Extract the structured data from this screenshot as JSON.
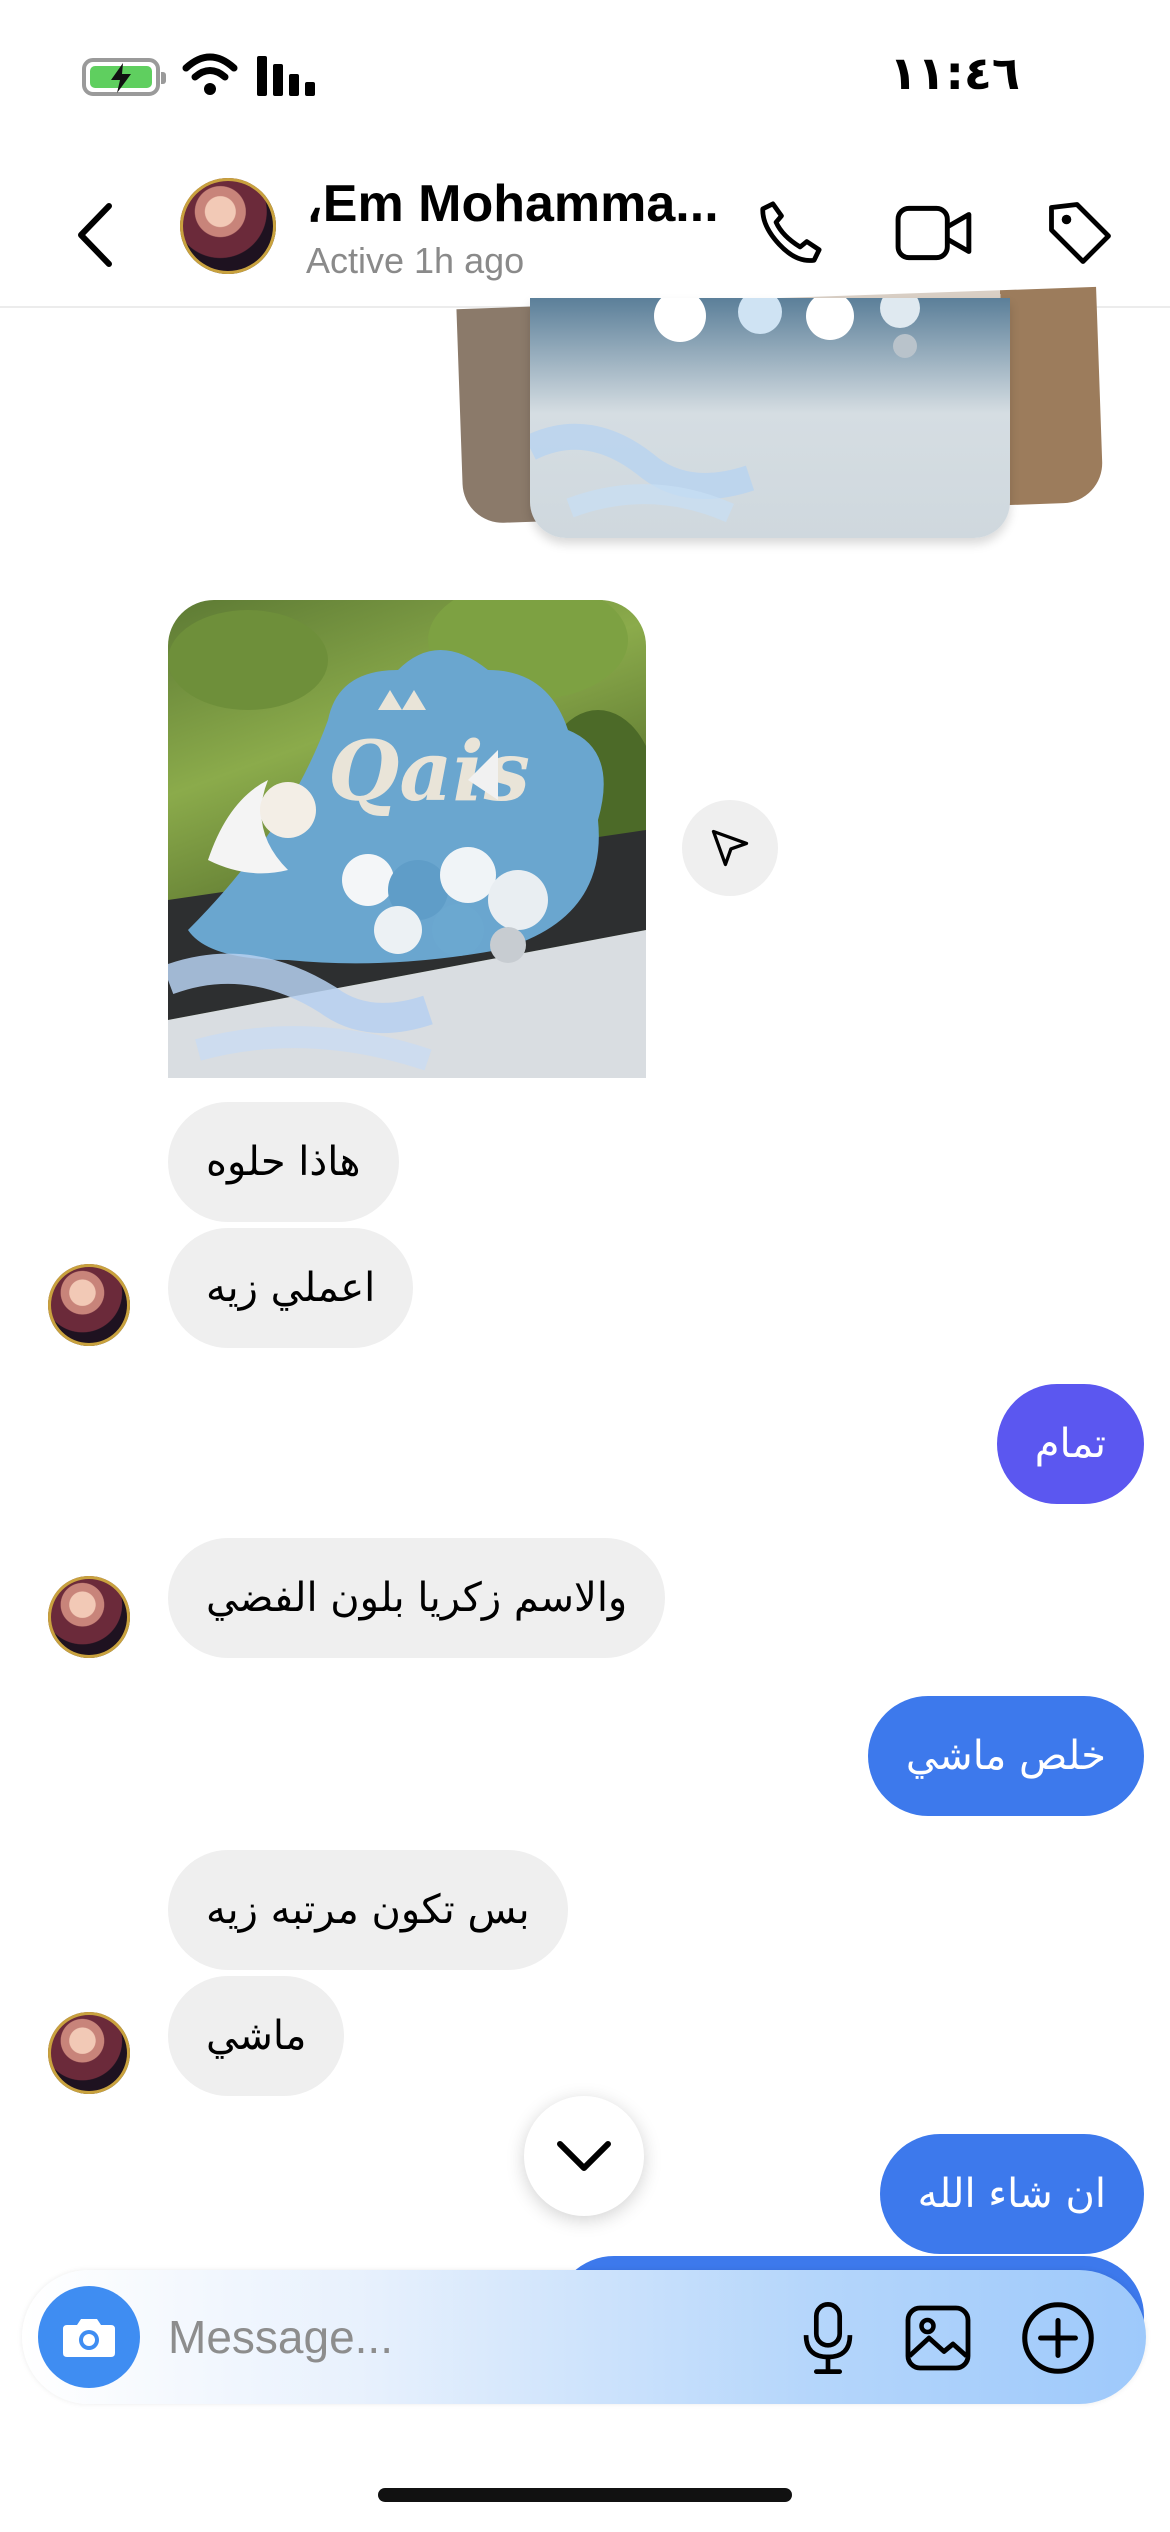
{
  "status_bar": {
    "time": "١١:٤٦",
    "icons": [
      "battery-charging-icon",
      "wifi-icon",
      "signal-icon"
    ]
  },
  "header": {
    "contact_name": "،Em Mohamma...",
    "contact_status": "Active 1h ago",
    "icons": [
      "back-arrow-icon",
      "phone-icon",
      "video-call-icon",
      "tag-icon"
    ]
  },
  "messages": [
    {
      "side": "received",
      "text": "هاذا حلوه"
    },
    {
      "side": "received",
      "text": "اعملي زيه"
    },
    {
      "side": "sent",
      "text": "تمام"
    },
    {
      "side": "received",
      "text": "والاسم زكريا بلون الفضي"
    },
    {
      "side": "sent",
      "text": "خلص ماشي"
    },
    {
      "side": "received",
      "text": "بس تكون مرتبه زيه"
    },
    {
      "side": "received",
      "text": "ماشي"
    },
    {
      "side": "sent",
      "text": "ان شاء الله"
    }
  ],
  "post": {
    "image_text": "Qais"
  },
  "composer": {
    "placeholder": "Message...",
    "icons": [
      "camera-icon",
      "microphone-icon",
      "gallery-icon",
      "plus-circle-icon"
    ]
  },
  "colors": {
    "sent_purple": "#5b57f0",
    "sent_blue": "#3d79ec",
    "received_bg": "#efefef",
    "camera_blue": "#3f8df2"
  }
}
